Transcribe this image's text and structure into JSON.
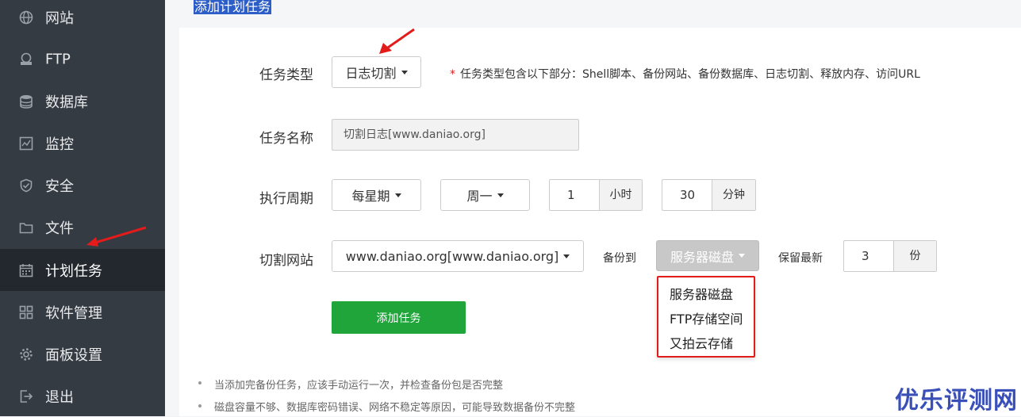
{
  "sidebar": {
    "items": [
      {
        "label": "网站",
        "icon": "globe-icon"
      },
      {
        "label": "FTP",
        "icon": "ftp-icon"
      },
      {
        "label": "数据库",
        "icon": "database-icon"
      },
      {
        "label": "监控",
        "icon": "monitor-icon"
      },
      {
        "label": "安全",
        "icon": "shield-icon"
      },
      {
        "label": "文件",
        "icon": "folder-icon"
      },
      {
        "label": "计划任务",
        "icon": "calendar-icon"
      },
      {
        "label": "软件管理",
        "icon": "apps-icon"
      },
      {
        "label": "面板设置",
        "icon": "gear-icon"
      },
      {
        "label": "退出",
        "icon": "logout-icon"
      }
    ],
    "active": "计划任务"
  },
  "page": {
    "title": "添加计划任务"
  },
  "form": {
    "task_type_label": "任务类型",
    "task_type_value": "日志切割",
    "task_type_hint_star": "*",
    "task_type_hint": "任务类型包含以下部分：Shell脚本、备份网站、备份数据库、日志切割、释放内存、访问URL",
    "task_name_label": "任务名称",
    "task_name_value": "切割日志[www.daniao.org]",
    "cycle_label": "执行周期",
    "cycle_value": "每星期",
    "weekday_value": "周一",
    "hour_value": "1",
    "hour_unit": "小时",
    "minute_value": "30",
    "minute_unit": "分钟",
    "site_label": "切割网站",
    "site_value": "www.daniao.org[www.daniao.org]",
    "backup_to_label": "备份到",
    "backup_to_value": "服务器磁盘",
    "backup_options": [
      "服务器磁盘",
      "FTP存储空间",
      "又拍云存储"
    ],
    "keep_label": "保留最新",
    "keep_value": "3",
    "keep_unit": "份",
    "add_button": "添加任务"
  },
  "notes": [
    "当添加完备份任务，应该手动运行一次，并检查备份包是否完整",
    "磁盘容量不够、数据库密码错误、网络不稳定等原因，可能导致数据备份不完整"
  ],
  "watermark": "优乐评测网",
  "colors": {
    "sidebar": "#353b43",
    "active": "#23282e",
    "accent_green": "#20a53a",
    "highlight_red": "#e31b1b",
    "title_bg": "#2d5ec7"
  }
}
